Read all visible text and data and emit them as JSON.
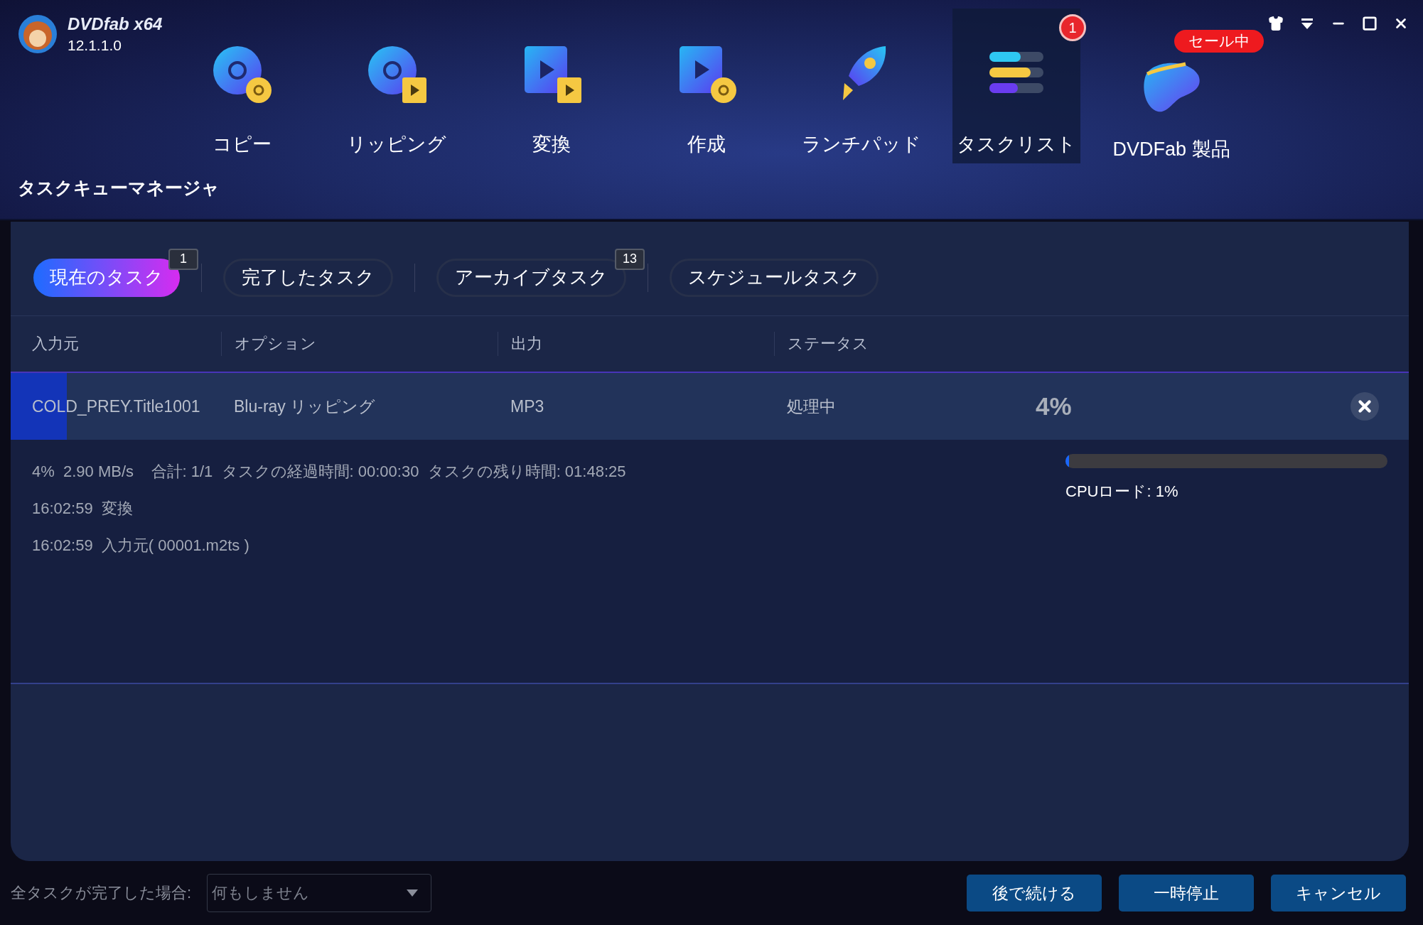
{
  "app": {
    "name": "DVDfab x64",
    "version": "12.1.1.0"
  },
  "nav": [
    {
      "label": "コピー",
      "kind": "disc-copy",
      "selected": false
    },
    {
      "label": "リッピング",
      "kind": "disc-film",
      "selected": false
    },
    {
      "label": "変換",
      "kind": "film-film",
      "selected": false
    },
    {
      "label": "作成",
      "kind": "film-disc",
      "selected": false
    },
    {
      "label": "ランチパッド",
      "kind": "rocket",
      "selected": false
    },
    {
      "label": "タスクリスト",
      "kind": "bars",
      "selected": true,
      "badge": "1"
    },
    {
      "label": "DVDFab 製品",
      "kind": "blob",
      "selected": false,
      "promo": "セール中"
    }
  ],
  "section_title": "タスクキューマネージャ",
  "tabs": [
    {
      "label": "現在のタスク",
      "selected": true,
      "count": "1"
    },
    {
      "label": "完了したタスク",
      "selected": false
    },
    {
      "label": "アーカイブタスク",
      "selected": false,
      "count": "13"
    },
    {
      "label": "スケジュールタスク",
      "selected": false
    }
  ],
  "table": {
    "columns": [
      "入力元",
      "オプション",
      "出力",
      "ステータス"
    ],
    "rows": [
      {
        "source": "COLD_PREY.Title1001",
        "option": "Blu-ray リッピング",
        "output": "MP3",
        "status": "処理中",
        "percent": "4%",
        "level": 0.04,
        "details": [
          "4%  2.90 MB/s    合計: 1/1  タスクの経過時間: 00:00:30  タスクの残り時間: 01:48:25",
          "16:02:59  変換",
          "16:02:59  入力元( 00001.m2ts )"
        ],
        "cpu": {
          "label": "CPUロード:  1%",
          "level": 0.01
        }
      }
    ]
  },
  "footer": {
    "label": "全タスクが完了した場合:",
    "select": "何もしません",
    "buttons": [
      "後で続ける",
      "一時停止",
      "キャンセル"
    ]
  }
}
